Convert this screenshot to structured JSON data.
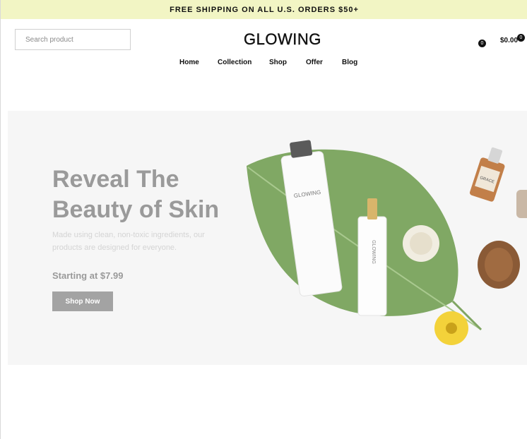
{
  "announcement": {
    "text": "FREE SHIPPING ON ALL U.S. ORDERS $50+"
  },
  "header": {
    "search_placeholder": "Search product",
    "logo": "GLOWING",
    "wishlist_count": "0",
    "cart_total": "$0.00",
    "cart_count": "0"
  },
  "nav": {
    "items": [
      {
        "label": "Home"
      },
      {
        "label": "Collection"
      },
      {
        "label": "Shop"
      },
      {
        "label": "Offer"
      },
      {
        "label": "Blog"
      }
    ]
  },
  "hero": {
    "title_line1": "Reveal The",
    "title_line2": "Beauty of Skin",
    "description": "Made using clean, non-toxic ingredients, our products are designed for everyone.",
    "price_text": "Starting at $7.99",
    "button_label": "Shop Now",
    "product_tube_label": "GLOWING",
    "product_bottle_label": "GLOWING",
    "serum_label": "GRACE"
  },
  "colors": {
    "announcement_bg": "#f2f5c4",
    "hero_bg": "#f6f6f6",
    "leaf_green": "#6f9a52",
    "button_bg": "#a3a3a3"
  }
}
